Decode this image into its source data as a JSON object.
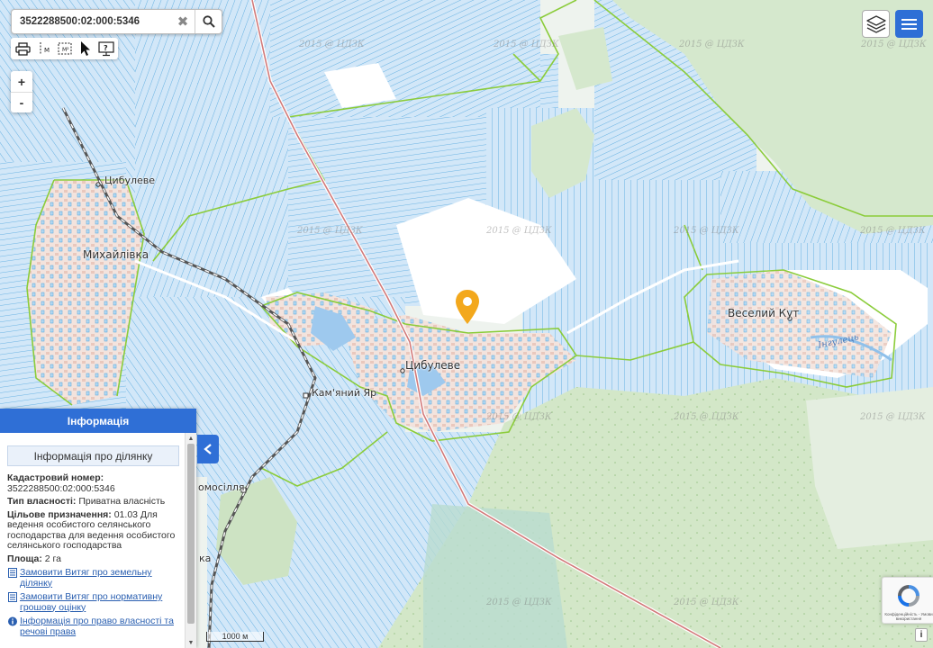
{
  "search": {
    "value": "3522288500:02:000:5346",
    "clear_icon": "close-icon",
    "search_icon": "search-icon"
  },
  "toolbar": {
    "tools": [
      "print-icon",
      "measure-distance-icon",
      "measure-area-icon",
      "pointer-icon",
      "info-screen-icon"
    ],
    "distance_label": "M",
    "area_label": "M²"
  },
  "zoom": {
    "in_label": "+",
    "out_label": "-"
  },
  "map": {
    "watermark": "2015 @ ЦДЗК",
    "places": {
      "tsybuleve_north": "Цибулеве",
      "mykhailivka": "Михайлівка",
      "tsybuleve": "Цибулеве",
      "kamianyi_yar": "Кам'яний Яр",
      "veselyi_kut": "Веселий Кут",
      "komosillia": "омосілля",
      "ka": "ка"
    },
    "river_label": "Інгулець",
    "marker_icon": "map-pin-icon",
    "colors": {
      "parcel_fill": "#cfe5f7",
      "parcel_line": "#4aa3dd",
      "boundary": "#8ccc3a",
      "forest": "#d3e7c8",
      "settlement": "#f5dcd2"
    }
  },
  "controls": {
    "layers_icon": "layers-icon",
    "menu_icon": "menu-icon",
    "collapse_icon": "chevron-left-icon"
  },
  "info": {
    "header": "Інформація",
    "subtitle": "Інформація про ділянку",
    "cadastral_label": "Кадастровий номер:",
    "cadastral_value": "3522288500:02:000:5346",
    "ownership_label": "Тип власності:",
    "ownership_value": "Приватна власність",
    "purpose_label": "Цільове призначення:",
    "purpose_value": "01.03 Для ведення особистого селянського господарства для ведення особистого селянського господарства",
    "area_label": "Площа:",
    "area_value": "2 га",
    "links": [
      "Замовити Витяг про земельну ділянку",
      "Замовити Витяг про нормативну грошову оцінку",
      "Інформація про право власності та речові права"
    ]
  },
  "scale_label": "1000 м",
  "recaptcha_text": "Конфіденційність - Умови використання",
  "info_corner_label": "i"
}
